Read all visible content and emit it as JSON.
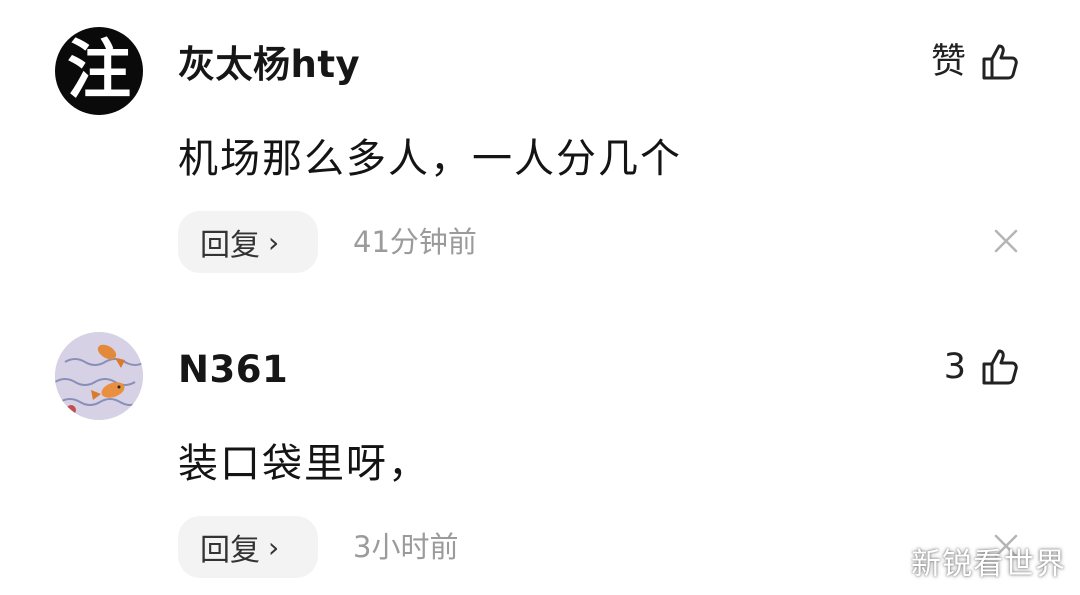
{
  "comments": [
    {
      "username": "灰太杨hty",
      "avatar": {
        "text": "注",
        "style": "black-ink-calligraphy"
      },
      "like_label": "赞",
      "content": "机场那么多人，一人分几个",
      "reply_label": "回复",
      "time": "41分钟前"
    },
    {
      "username": "N361",
      "avatar": {
        "text": "",
        "style": "goldfish-painting"
      },
      "like_label": "3",
      "content": "装口袋里呀，",
      "reply_label": "回复",
      "time": "3小时前"
    }
  ],
  "icons": {
    "like": "thumbs-up-icon",
    "close": "close-icon",
    "chevron": "chevron-right-icon"
  },
  "colors": {
    "text": "#1a1a1a",
    "meta": "#9b9b9b",
    "reply_bg": "#f3f3f3"
  },
  "watermark": "新锐看世界"
}
